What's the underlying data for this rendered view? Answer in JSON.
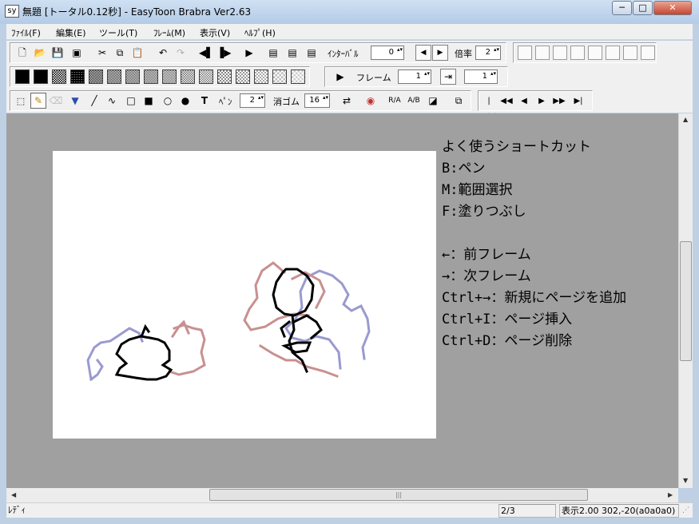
{
  "window": {
    "title": "無題 [トータル0.12秒] - EasyToon Brabra  Ver2.63",
    "min_label": "─",
    "max_label": "□",
    "close_label": "✕",
    "app_icon": "sy"
  },
  "menu": {
    "file": "ﾌｧｲﾙ(F)",
    "edit": "編集(E)",
    "tools": "ツール(T)",
    "frame": "ﾌﾚｰﾑ(M)",
    "view": "表示(V)",
    "help": "ﾍﾙﾌﾟ(H)"
  },
  "toolbar1": {
    "interval_label": "ｲﾝﾀｰﾊﾞﾙ",
    "interval_value": "0",
    "zoom_label": "倍率",
    "zoom_value": "2"
  },
  "toolbar2": {
    "frame_label": "フレーム",
    "frame_value": "1",
    "frame_value2": "1"
  },
  "toolbar3": {
    "pen_label": "ﾍﾟﾝ",
    "pen_size": "2",
    "eraser_label": "消ゴム",
    "eraser_size": "16",
    "text_tool": "T",
    "ra_label": "R/A",
    "ab_label": "A/B"
  },
  "shortcuts": {
    "title": "よく使うショートカット",
    "lines": [
      "B:ペン",
      "M:範囲選択",
      "F:塗りつぶし",
      "",
      "←：前フレーム",
      "→：次フレーム",
      "Ctrl+→：新規にページを追加",
      "Ctrl+I：ページ挿入",
      "Ctrl+D：ページ削除"
    ]
  },
  "status": {
    "ready": "ﾚﾃﾞｨ",
    "page": "2/3",
    "zoom_coords": "表示2.00  302,-20(a0a0a0)"
  },
  "colors": {
    "workspace_bg": "#a0a0a0",
    "canvas_bg": "#ffffff",
    "onion_red": "#c89090",
    "onion_blue": "#9a9ad0",
    "ink": "#000000"
  }
}
